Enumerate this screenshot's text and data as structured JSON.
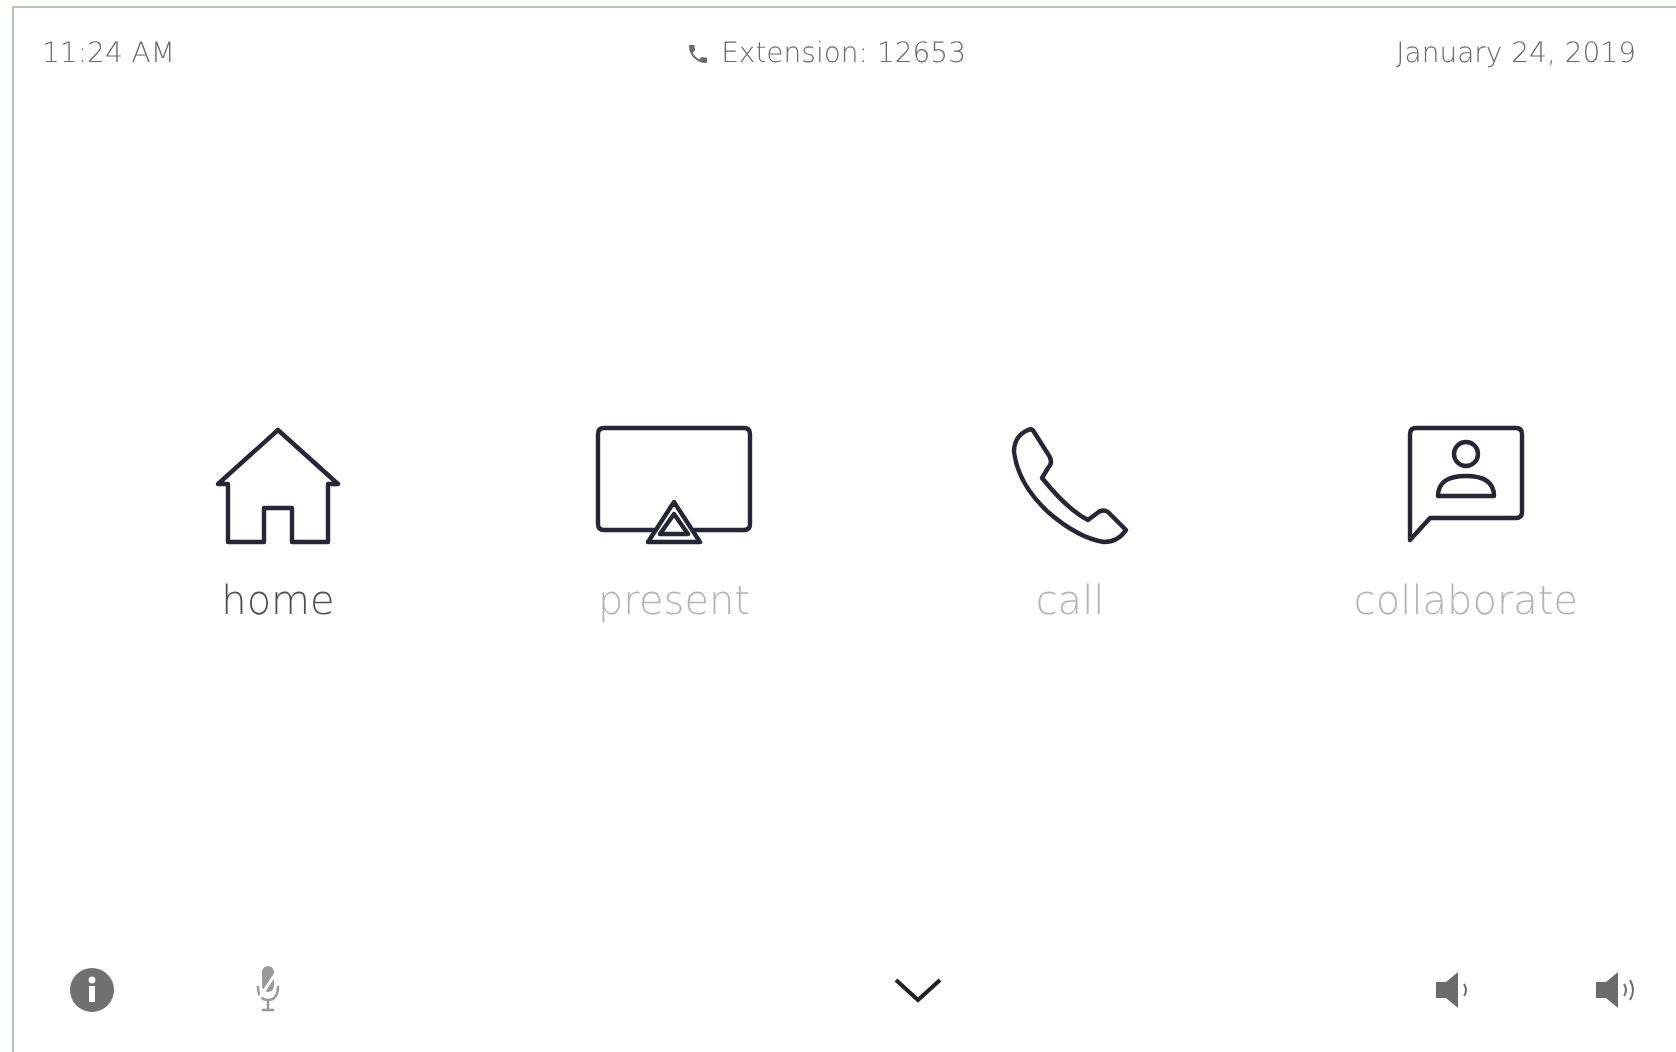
{
  "status_bar": {
    "time": "11:24 AM",
    "extension": "Extension: 12653",
    "date": "January 24, 2019"
  },
  "nav_items": [
    {
      "kind": "home",
      "label": "home",
      "selected": true
    },
    {
      "kind": "present",
      "label": "present",
      "selected": false
    },
    {
      "kind": "call",
      "label": "call",
      "selected": false
    },
    {
      "kind": "collaborate",
      "label": "collaborate",
      "selected": false
    }
  ],
  "bottom_bar": {
    "microphone": {
      "muted": true
    }
  }
}
